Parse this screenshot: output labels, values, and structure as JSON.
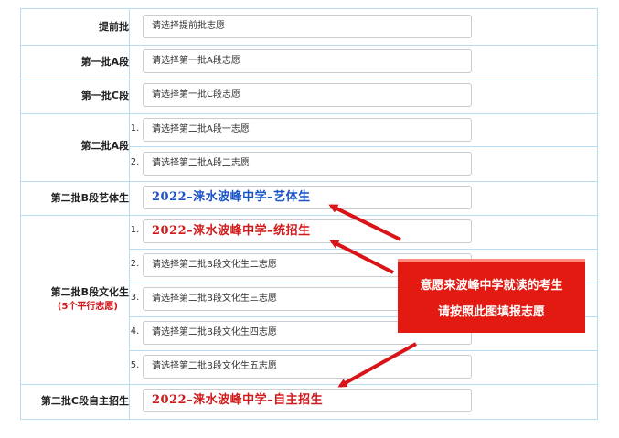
{
  "colors": {
    "grid_line": "#b9dcef",
    "arrow_red": "#d81418",
    "text_red": "#d0191a",
    "text_blue": "#1a53c4",
    "callout_bg": "#e21a12"
  },
  "rows": {
    "tiqianpi": {
      "label": "提前批",
      "placeholder": "请选择提前批志愿"
    },
    "yipi_a": {
      "label": "第一批A段",
      "placeholder": "请选择第一批A段志愿"
    },
    "yipi_c": {
      "label": "第一批C段",
      "placeholder": "请选择第一批C段志愿"
    },
    "erpi_a": {
      "label": "第二批A段",
      "choices": [
        {
          "num": "1.",
          "placeholder": "请选择第二批A段一志愿"
        },
        {
          "num": "2.",
          "placeholder": "请选择第二批A段二志愿"
        }
      ]
    },
    "erpi_b_art": {
      "label": "第二批B段艺体生",
      "value": "2022–涞水波峰中学–艺体生"
    },
    "erpi_b_wenhua": {
      "label": "第二批B段文化生",
      "note": "(5个平行志愿)",
      "choices": [
        {
          "num": "1.",
          "value": "2022–涞水波峰中学–统招生"
        },
        {
          "num": "2.",
          "placeholder": "请选择第二批B段文化生二志愿"
        },
        {
          "num": "3.",
          "placeholder": "请选择第二批B段文化生三志愿"
        },
        {
          "num": "4.",
          "placeholder": "请选择第二批B段文化生四志愿"
        },
        {
          "num": "5.",
          "placeholder": "请选择第二批B段文化生五志愿"
        }
      ]
    },
    "erpi_c_zizhu": {
      "label": "第二批C段自主招生",
      "value": "2022–涞水波峰中学–自主招生"
    }
  },
  "callout": {
    "line1": "意愿来波峰中学就读的考生",
    "line2": "请按照此图填报志愿"
  }
}
